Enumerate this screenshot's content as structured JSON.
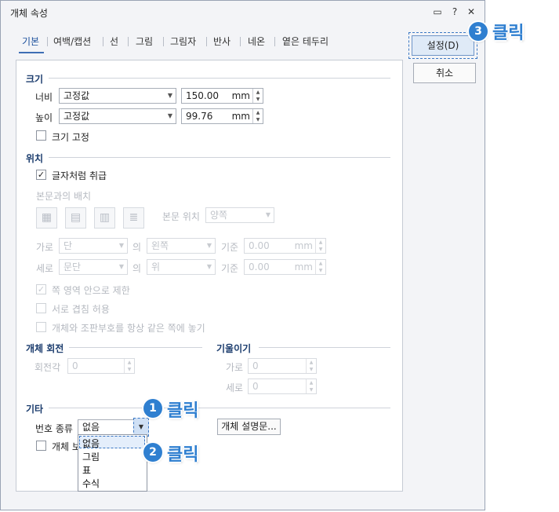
{
  "window": {
    "title": "개체 속성",
    "controls": [
      "chat-icon",
      "help-icon",
      "close-icon"
    ]
  },
  "tabs": [
    "기본",
    "여백/캡션",
    "선",
    "그림",
    "그림자",
    "반사",
    "네온",
    "옅은 테두리"
  ],
  "buttons": {
    "ok": "설정(D)",
    "cancel": "취소"
  },
  "size": {
    "section": "크기",
    "width_label": "너비",
    "width_mode": "고정값",
    "width_value": "150.00",
    "width_unit": "mm",
    "height_label": "높이",
    "height_mode": "고정값",
    "height_value": "99.76",
    "height_unit": "mm",
    "lock_label": "크기 고정"
  },
  "position": {
    "section": "위치",
    "as_char_label": "글자처럼 취급",
    "wrap_label": "본문과의 배치",
    "body_pos_label": "본문 위치",
    "body_pos_value": "양쪽",
    "horiz_label": "가로",
    "horiz_ref": "단",
    "horiz_of": "의",
    "horiz_align": "왼쪽",
    "horiz_base": "기준",
    "horiz_value": "0.00",
    "horiz_unit": "mm",
    "vert_label": "세로",
    "vert_ref": "문단",
    "vert_of": "의",
    "vert_align": "위",
    "vert_base": "기준",
    "vert_value": "0.00",
    "vert_unit": "mm",
    "opt1": "쪽 영역 안으로 제한",
    "opt2": "서로 겹침 허용",
    "opt3": "개체와 조판부호를 항상 같은 쪽에 놓기"
  },
  "rotation": {
    "section": "개체 회전",
    "angle_label": "회전각",
    "angle_value": "0"
  },
  "skew": {
    "section": "기울이기",
    "x_label": "가로",
    "x_value": "0",
    "y_label": "세로",
    "y_value": "0"
  },
  "misc": {
    "section": "기타",
    "number_type_label": "번호 종류",
    "number_type_value": "없음",
    "protect_label": "개체 보",
    "desc_button": "개체 설명문...",
    "dropdown_options": [
      "없음",
      "그림",
      "표",
      "수식"
    ]
  },
  "callouts": [
    {
      "num": "1",
      "text": "클릭"
    },
    {
      "num": "2",
      "text": "클릭"
    },
    {
      "num": "3",
      "text": "클릭"
    }
  ],
  "colors": {
    "accent": "#2f7fd0",
    "section": "#1c3d6e",
    "tab_active": "#1a4f9c"
  }
}
